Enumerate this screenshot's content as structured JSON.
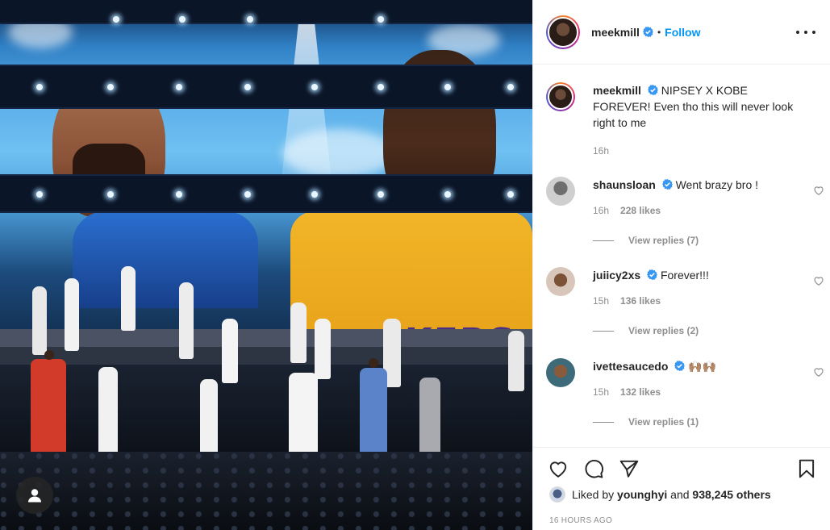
{
  "post": {
    "username": "meekmill",
    "follow_label": "Follow",
    "separator": "•"
  },
  "caption": {
    "username": "meekmill",
    "text": "NIPSEY X KOBE FOREVER! Even tho this will never look right to me",
    "time": "16h"
  },
  "comments": [
    {
      "username": "shaunsloan",
      "text": "Went brazy bro !",
      "time": "16h",
      "likes": "228 likes",
      "replies": "View replies (7)"
    },
    {
      "username": "juiicy2xs",
      "text": "Forever!!!",
      "time": "15h",
      "likes": "136 likes",
      "replies": "View replies (2)"
    },
    {
      "username": "ivettesaucedo",
      "text": "🙌🏽🙌🏽",
      "time": "15h",
      "likes": "132 likes",
      "replies": "View replies (1)"
    }
  ],
  "likes": {
    "prefix": "Liked by",
    "user": "younghyi",
    "connector": "and",
    "others": "938,245 others"
  },
  "timestamp": "16 HOURS AGO",
  "photo": {
    "jersey_text": "KERS"
  },
  "colors": {
    "accent": "#0095f6",
    "text": "#262626",
    "muted": "#8e8e8e",
    "verified": "#3897f0"
  },
  "icons": [
    "verified-icon",
    "more-options-icon",
    "heart-icon",
    "comment-icon",
    "share-icon",
    "bookmark-icon",
    "user-icon"
  ]
}
